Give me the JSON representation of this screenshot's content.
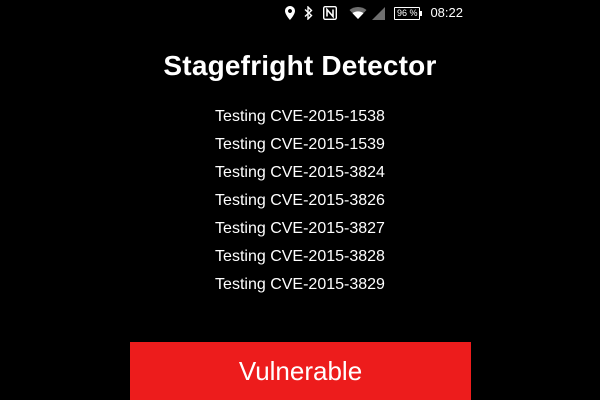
{
  "status_bar": {
    "icons": [
      "location-icon",
      "bluetooth-icon",
      "nfc-icon",
      "wifi-icon",
      "signal-icon"
    ],
    "battery_level": "96 %",
    "time": "08:22"
  },
  "app": {
    "title": "Stagefright Detector",
    "tests": [
      "Testing CVE-2015-1538",
      "Testing CVE-2015-1539",
      "Testing CVE-2015-3824",
      "Testing CVE-2015-3826",
      "Testing CVE-2015-3827",
      "Testing CVE-2015-3828",
      "Testing CVE-2015-3829"
    ],
    "result_label": "Vulnerable"
  },
  "colors": {
    "background": "#000000",
    "text": "#ffffff",
    "result_button": "#ed1c1c"
  }
}
